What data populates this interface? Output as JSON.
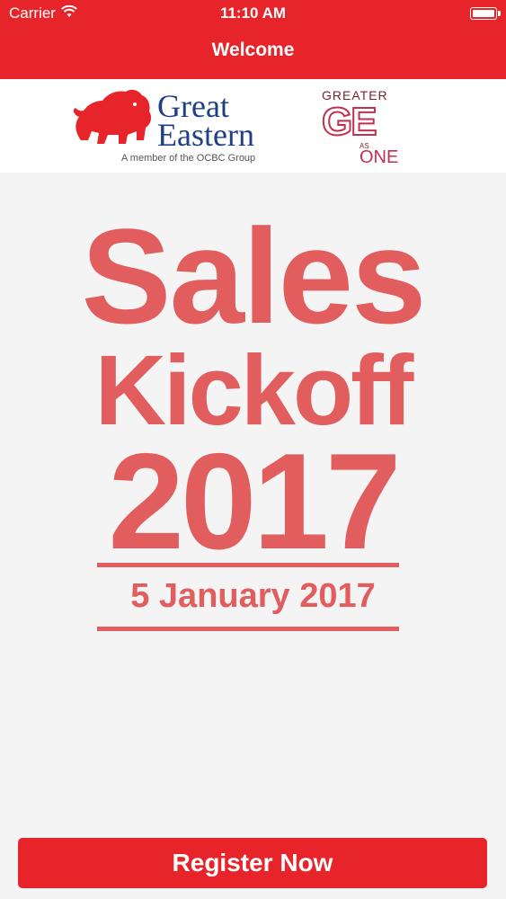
{
  "status_bar": {
    "carrier": "Carrier",
    "time": "11:10 AM"
  },
  "nav": {
    "title": "Welcome"
  },
  "logos": {
    "great_eastern": {
      "line1": "Great",
      "line2": "Eastern",
      "tagline": "A member of the OCBC Group"
    },
    "greater_ge": {
      "top": "GREATER",
      "mark": "GE",
      "as": "AS",
      "one": "ONE"
    }
  },
  "hero": {
    "title_line1": "Sales",
    "title_line2": "Kickoff",
    "year": "2017",
    "date": "5 January 2017"
  },
  "actions": {
    "register_label": "Register Now"
  },
  "colors": {
    "brand_red": "#e8242b",
    "hero_red": "#e25d5d",
    "ge_blue": "#1f3f86"
  }
}
